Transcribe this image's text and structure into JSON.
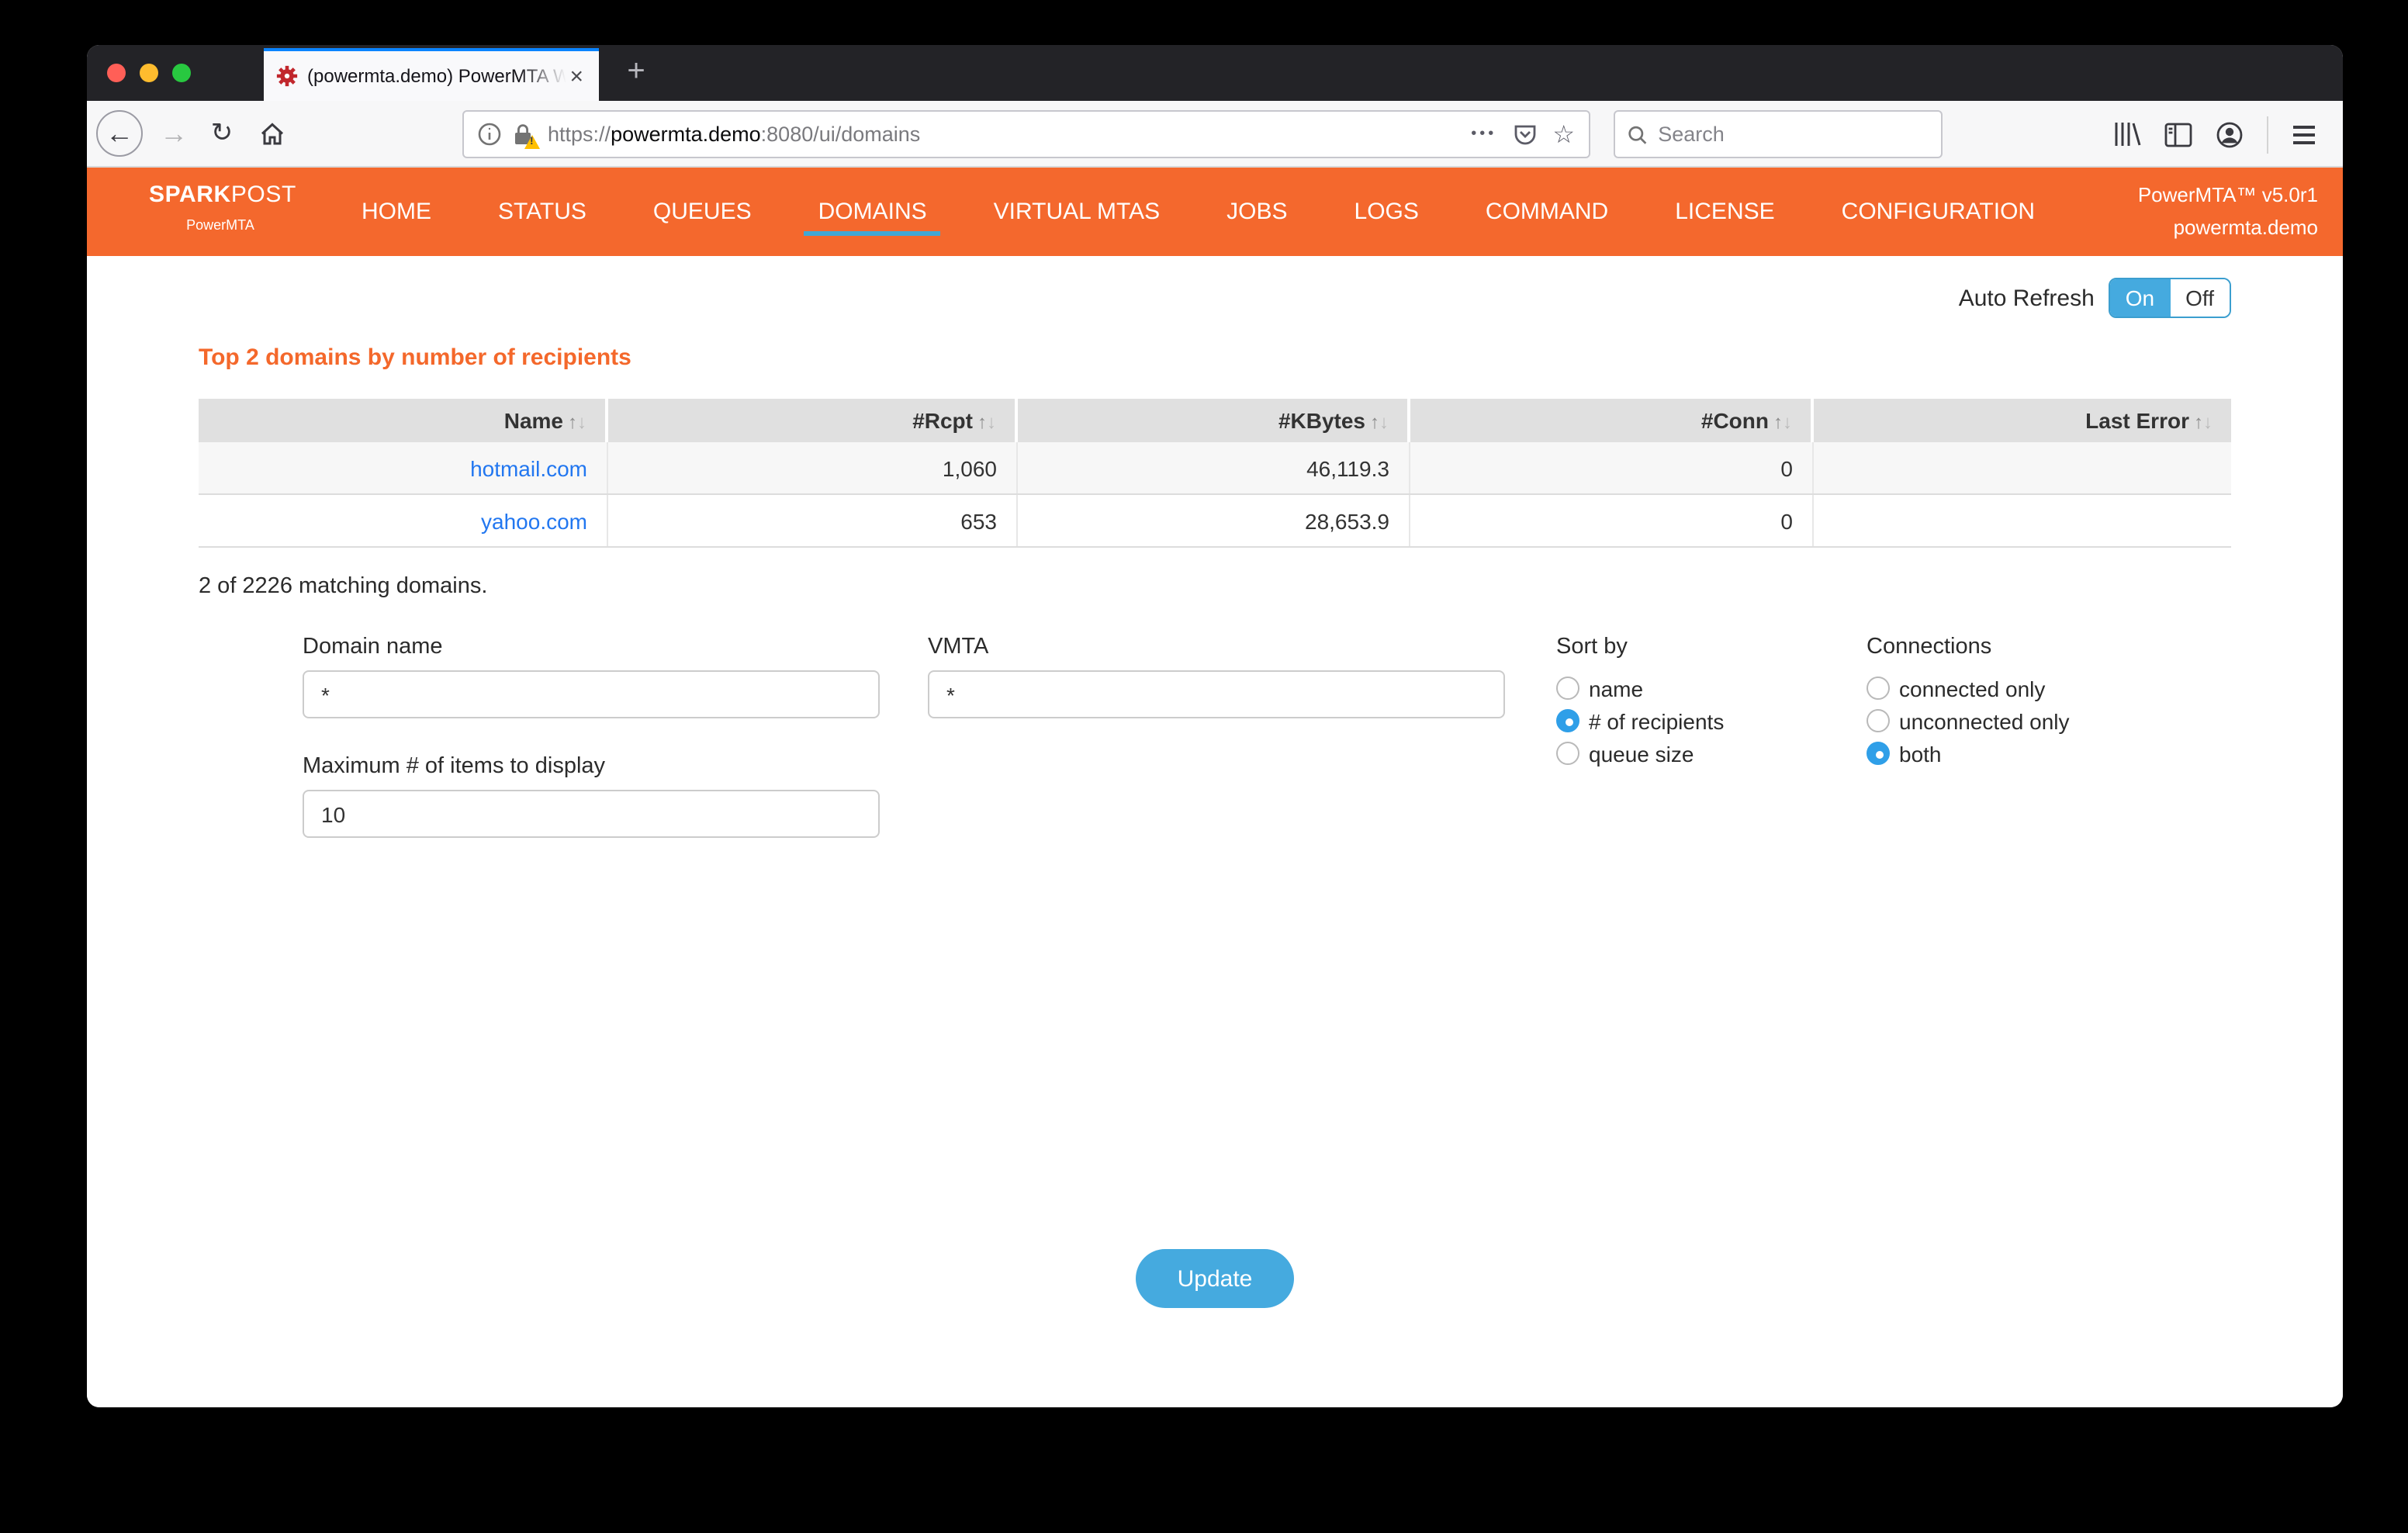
{
  "browser": {
    "tab": {
      "title": "(powermta.demo) PowerMTA W",
      "close_glyph": "×",
      "new_tab_glyph": "+"
    },
    "toolbar": {
      "back_glyph": "←",
      "forward_glyph": "→",
      "reload_glyph": "↻",
      "url": {
        "scheme": "https://",
        "host": "powermta.demo",
        "path": ":8080/ui/domains"
      },
      "page_actions_glyph": "•••",
      "bookmark_glyph": "☆",
      "search_placeholder": "Search"
    }
  },
  "navbar": {
    "brand": {
      "spark": "SPARK",
      "post": "POST",
      "product": "PowerMTA"
    },
    "items": [
      "HOME",
      "STATUS",
      "QUEUES",
      "DOMAINS",
      "VIRTUAL MTAS",
      "JOBS",
      "LOGS",
      "COMMAND",
      "LICENSE",
      "CONFIGURATION"
    ],
    "active_item": "DOMAINS",
    "active_index": 3,
    "version": "PowerMTA™ v5.0r1",
    "hostname": "powermta.demo"
  },
  "content": {
    "auto_refresh": {
      "label": "Auto Refresh",
      "on": "On",
      "off": "Off",
      "state": "on"
    },
    "heading": "Top 2 domains by number of recipients",
    "table": {
      "columns": [
        "Name",
        "#Rcpt",
        "#KBytes",
        "#Conn",
        "Last Error"
      ],
      "sort_asc_glyph": "↑",
      "sort_desc_glyph": "↓",
      "rows": [
        {
          "name": "hotmail.com",
          "rcpt": "1,060",
          "kbytes": "46,119.3",
          "conn": "0",
          "last_error": ""
        },
        {
          "name": "yahoo.com",
          "rcpt": "653",
          "kbytes": "28,653.9",
          "conn": "0",
          "last_error": ""
        }
      ]
    },
    "summary": "2 of 2226 matching domains.",
    "form": {
      "domain_name": {
        "label": "Domain name",
        "value": "*"
      },
      "vmta": {
        "label": "VMTA",
        "value": "*"
      },
      "max_items": {
        "label": "Maximum # of items to display",
        "value": "10"
      },
      "sort_by": {
        "label": "Sort by",
        "options": [
          {
            "label": "name",
            "selected": false
          },
          {
            "label": "# of recipients",
            "selected": true
          },
          {
            "label": "queue size",
            "selected": false
          }
        ]
      },
      "connections": {
        "label": "Connections",
        "options": [
          {
            "label": "connected only",
            "selected": false
          },
          {
            "label": "unconnected only",
            "selected": false
          },
          {
            "label": "both",
            "selected": true
          }
        ]
      },
      "update_label": "Update"
    }
  },
  "colors": {
    "navbar_orange": "#f4682d",
    "heading_orange": "#f4682b",
    "accent_blue": "#45aadf",
    "active_underline_blue": "#42a7d4",
    "link_blue": "#2277f0",
    "radio_blue": "#2f9fe8"
  }
}
